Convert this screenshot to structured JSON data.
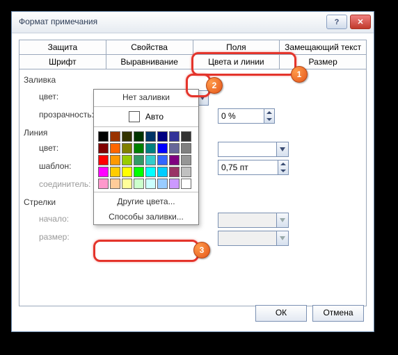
{
  "window": {
    "title": "Формат примечания"
  },
  "tabs_row1": [
    "Защита",
    "Свойства",
    "Поля",
    "Замещающий текст"
  ],
  "tabs_row2": [
    "Шрифт",
    "Выравнивание",
    "Цвета и линии",
    "Размер"
  ],
  "fill": {
    "group": "Заливка",
    "color_label": "цвет:",
    "transparency_label": "прозрачность:",
    "transparency_value": "0 %"
  },
  "line": {
    "group": "Линия",
    "color_label": "цвет:",
    "template_label": "шаблон:",
    "connector_label": "соединитель:",
    "weight_value": "0,75 пт"
  },
  "arrows": {
    "group": "Стрелки",
    "start_label": "начало:",
    "size_label": "размер:"
  },
  "dropdown": {
    "no_fill": "Нет заливки",
    "auto": "Авто",
    "more_colors": "Другие цвета...",
    "fill_effects": "Способы заливки..."
  },
  "palette": [
    [
      "#000000",
      "#993300",
      "#333300",
      "#003300",
      "#003366",
      "#000080",
      "#333399",
      "#333333"
    ],
    [
      "#800000",
      "#ff6600",
      "#808000",
      "#008000",
      "#008080",
      "#0000ff",
      "#666699",
      "#808080"
    ],
    [
      "#ff0000",
      "#ff9900",
      "#99cc00",
      "#339966",
      "#33cccc",
      "#3366ff",
      "#800080",
      "#969696"
    ],
    [
      "#ff00ff",
      "#ffcc00",
      "#ffff00",
      "#00ff00",
      "#00ffff",
      "#00ccff",
      "#993366",
      "#c0c0c0"
    ],
    [
      "#ff99cc",
      "#ffcc99",
      "#ffff99",
      "#ccffcc",
      "#ccffff",
      "#99ccff",
      "#cc99ff",
      "#ffffff"
    ]
  ],
  "buttons": {
    "ok": "ОК",
    "cancel": "Отмена"
  },
  "callouts": {
    "b1": "1",
    "b2": "2",
    "b3": "3"
  }
}
